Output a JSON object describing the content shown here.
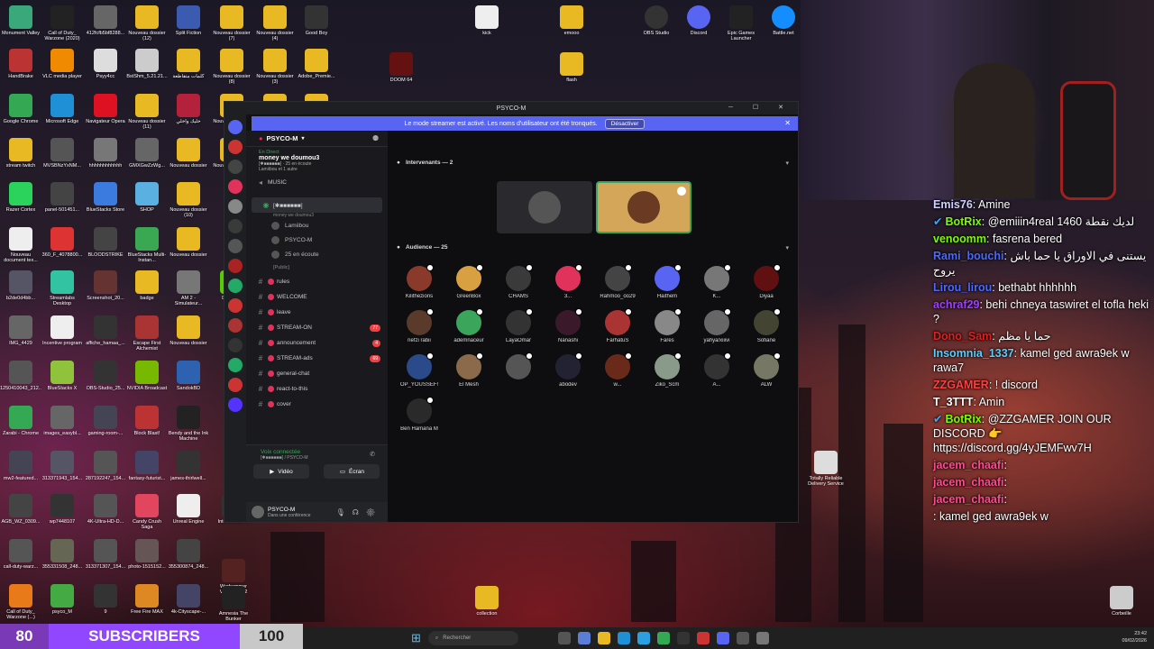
{
  "desktop_icons": [
    {
      "label": "Monument Valley",
      "color": "#3aa87a"
    },
    {
      "label": "Call of Duty_ Warzone (2020)",
      "color": "#222"
    },
    {
      "label": "412fcfb5bf8288...",
      "color": "#666"
    },
    {
      "label": "Nouveau dossier (12)",
      "color": "#e8b923"
    },
    {
      "label": "Split Fiction",
      "color": "#3b5bb0"
    },
    {
      "label": "Nouveau dossier (7)",
      "color": "#e8b923"
    },
    {
      "label": "Nouveau dossier (4)",
      "color": "#e8b923"
    },
    {
      "label": "Good Boy",
      "color": "#333"
    },
    {
      "label": "HandBrake",
      "color": "#b33"
    },
    {
      "label": "VLC media player",
      "color": "#f08a00"
    },
    {
      "label": "Psyy4cc",
      "color": "#ddd"
    },
    {
      "label": "BstShm_5.21.21...",
      "color": "#ccc"
    },
    {
      "label": "كلمات متقاطعة",
      "color": "#e8b923"
    },
    {
      "label": "Nouveau dossier (8)",
      "color": "#e8b923"
    },
    {
      "label": "Nouveau dossier (3)",
      "color": "#e8b923"
    },
    {
      "label": "Adobe_Premie...",
      "color": "#e8b923"
    },
    {
      "label": "Google Chrome",
      "color": "#34a853"
    },
    {
      "label": "Microsoft Edge",
      "color": "#1f8fd6"
    },
    {
      "label": "Navigateur Opera",
      "color": "#d12"
    },
    {
      "label": "Nouveau dossier (11)",
      "color": "#e8b923"
    },
    {
      "label": "خليك واخلي",
      "color": "#b3223a"
    },
    {
      "label": "Nouveau dossier (2)",
      "color": "#e8b923"
    },
    {
      "label": "Nouveau dossier (5)",
      "color": "#e8b923"
    },
    {
      "label": "Nouveau dossier (9)",
      "color": "#e8b923"
    },
    {
      "label": "stream twitch",
      "color": "#e8b923"
    },
    {
      "label": "MVSBNzYxNM...",
      "color": "#555"
    },
    {
      "label": "hhhhhhhhhhhh",
      "color": "#777"
    },
    {
      "label": "GMXGwZzWg...",
      "color": "#666"
    },
    {
      "label": "Nouveau dossier",
      "color": "#e8b923"
    },
    {
      "label": "Nouveau dossier (6)",
      "color": "#e8b923"
    },
    {
      "label": "Nouveau dossier (10)",
      "color": "#e8b923"
    },
    {
      "label": "Razer Cortex",
      "color": "#2bd35c"
    },
    {
      "label": "panel-501451...",
      "color": "#444"
    },
    {
      "label": "BlueStacks Store",
      "color": "#3b7be0"
    },
    {
      "label": "SHOP",
      "color": "#5ab0e0"
    },
    {
      "label": "Nouveau dossier (10)",
      "color": "#e8b923"
    },
    {
      "label": "Nouveau document tex...",
      "color": "#eee"
    },
    {
      "label": "360_F_4078800...",
      "color": "#d33"
    },
    {
      "label": "BLOODSTRIKE",
      "color": "#444"
    },
    {
      "label": "BlueStacks Multi-Instan...",
      "color": "#3aa853"
    },
    {
      "label": "Nouveau dossier",
      "color": "#e8b923"
    },
    {
      "label": "b2de0d4bb...",
      "color": "#556"
    },
    {
      "label": "Streamlabs Desktop",
      "color": "#31c3a2"
    },
    {
      "label": "Screenshot_20...",
      "color": "#633"
    },
    {
      "label": "badge",
      "color": "#e8b923"
    },
    {
      "label": "AM 2 - Simulateur...",
      "color": "#777"
    },
    {
      "label": "Duolingo",
      "color": "#58cc02"
    },
    {
      "label": "IMG_4429",
      "color": "#666"
    },
    {
      "label": "Incentive program",
      "color": "#eee"
    },
    {
      "label": "affiche_hamaa_...",
      "color": "#333"
    },
    {
      "label": "Escape First Alchemist",
      "color": "#a33"
    },
    {
      "label": "Nouveau dossier",
      "color": "#e8b923"
    },
    {
      "label": "1250410043_212...",
      "color": "#555"
    },
    {
      "label": "BlueStacks X",
      "color": "#8fc33b"
    },
    {
      "label": "OBS-Studio_25...",
      "color": "#333"
    },
    {
      "label": "NVIDIA Broadcast",
      "color": "#76b900"
    },
    {
      "label": "SandokBD",
      "color": "#2c62b0"
    },
    {
      "label": "Zarabi - Chrome",
      "color": "#34a853"
    },
    {
      "label": "images_easybl...",
      "color": "#666"
    },
    {
      "label": "gaming-room-...",
      "color": "#445"
    },
    {
      "label": "Block Blast!",
      "color": "#b33"
    },
    {
      "label": "Bendy and the Ink Machine",
      "color": "#222"
    },
    {
      "label": "mw2-featured...",
      "color": "#445"
    },
    {
      "label": "313371943_154...",
      "color": "#556"
    },
    {
      "label": "287192247_154...",
      "color": "#555"
    },
    {
      "label": "fantasy-futurist...",
      "color": "#446"
    },
    {
      "label": "james-thirlwell...",
      "color": "#333"
    },
    {
      "label": "AGB_WZ_0309...",
      "color": "#444"
    },
    {
      "label": "wp7448107",
      "color": "#333"
    },
    {
      "label": "4K-Ultra-HD-D...",
      "color": "#555"
    },
    {
      "label": "Candy Crush Saga",
      "color": "#e2455e"
    },
    {
      "label": "Unreal Engine",
      "color": "#eee"
    },
    {
      "label": "call-duty-warz...",
      "color": "#555"
    },
    {
      "label": "355331508_248...",
      "color": "#665"
    },
    {
      "label": "313371307_154...",
      "color": "#555"
    },
    {
      "label": "photo-1515152...",
      "color": "#655"
    },
    {
      "label": "355300874_248...",
      "color": "#444"
    },
    {
      "label": "Call of Duty_ Warzone (...)",
      "color": "#e87a1a"
    },
    {
      "label": "psyco_M",
      "color": "#4a4"
    },
    {
      "label": "9",
      "color": "#333"
    },
    {
      "label": "Free Fire MAX",
      "color": "#d82"
    },
    {
      "label": "4k-Cityscape-...",
      "color": "#446"
    }
  ],
  "desktop_icons2": [
    {
      "label": "kick",
      "color": "#eee"
    },
    {
      "label": "emooo",
      "color": "#e8b923"
    },
    {
      "label": "OBS Studio",
      "color": "#333"
    },
    {
      "label": "Discord",
      "color": "#5865f2"
    },
    {
      "label": "Epic Games Launcher",
      "color": "#222"
    },
    {
      "label": "Battle.net",
      "color": "#148eff"
    },
    {
      "label": "DOOM 64",
      "color": "#611"
    },
    {
      "label": "flash",
      "color": "#e8b923"
    },
    {
      "label": "Intervention ...",
      "color": "#333"
    },
    {
      "label": "Warhammer Vermintide 2",
      "color": "#522"
    },
    {
      "label": "Amnesia The Bunker",
      "color": "#222"
    },
    {
      "label": "Totally Reliable Delivery Service",
      "color": "#ddd"
    },
    {
      "label": "collection",
      "color": "#e8b923"
    },
    {
      "label": "Corbeille",
      "color": "#ccc"
    }
  ],
  "discord": {
    "window_title": "PSYCO-M",
    "banner_text": "Le mode streamer est activé. Les noms d'utilisateur ont été tronqués.",
    "banner_button": "Désactiver",
    "server_name": "PSYCO-M",
    "event_status": "En Direct",
    "event_title": "money we doumou3",
    "event_sub": "[✱■■■■■■] · 25 en écoute",
    "event_users": "Lamiibou et 1 autre",
    "music": "MUSIC",
    "stage_channel": "[✱■■■■■■]",
    "stage_sub": "money we doumou3",
    "voice_users": [
      "Lamiibou",
      "PSYCO-M",
      "25 en écoute"
    ],
    "public_cat": "[Public]",
    "channels": [
      {
        "name": "rules",
        "count": ""
      },
      {
        "name": "WELCOME",
        "count": ""
      },
      {
        "name": "leave",
        "count": ""
      },
      {
        "name": "STREAM-ON",
        "count": "77"
      },
      {
        "name": "announcement",
        "count": "4"
      },
      {
        "name": "STREAM-ads",
        "count": "69"
      },
      {
        "name": "general-chat",
        "count": ""
      },
      {
        "name": "react-to-this",
        "count": ""
      },
      {
        "name": "cover",
        "count": ""
      }
    ],
    "voice_connected": "Voix connectée",
    "voice_sub": "[✱■■■■■■] / PSYCO-M",
    "video_btn": "Vidéo",
    "screen_btn": "Écran",
    "user_name": "PSYCO-M",
    "user_status": "Dans une conférence",
    "speakers_label": "Intervenants — 2",
    "audience_label": "Audience — 25",
    "audience": [
      {
        "name": "Kilithezions",
        "color": "#8a3a2a"
      },
      {
        "name": "GreenBox",
        "color": "#d8a040"
      },
      {
        "name": "CHAMS",
        "color": "#3a3a3a"
      },
      {
        "name": "3...",
        "color": "#e0325a"
      },
      {
        "name": "Rahmoo_oo29",
        "color": "#444"
      },
      {
        "name": "Haithem",
        "color": "#5865f2"
      },
      {
        "name": "K...",
        "color": "#777"
      },
      {
        "name": "Diyaa",
        "color": "#601010"
      },
      {
        "name": "nefzi rabii",
        "color": "#5a3a2a"
      },
      {
        "name": "ademnaceur",
        "color": "#3ba55c"
      },
      {
        "name": "LayaOmar",
        "color": "#333"
      },
      {
        "name": "Nanashi",
        "color": "#3a1a2a"
      },
      {
        "name": "FarhatuS",
        "color": "#a33"
      },
      {
        "name": "Fares",
        "color": "#888"
      },
      {
        "name": "yahya/xiiivi",
        "color": "#666"
      },
      {
        "name": "Sofiane",
        "color": "#443"
      },
      {
        "name": "OP_YOUSSEF!",
        "color": "#2a4a8a"
      },
      {
        "name": "El Mesh",
        "color": "#8a6a4a"
      },
      {
        "name": "",
        "color": "#555"
      },
      {
        "name": "abodev",
        "color": "#223"
      },
      {
        "name": "w...",
        "color": "#6a2a1a"
      },
      {
        "name": "Ziko_Scm",
        "color": "#8a9a8a"
      },
      {
        "name": "A...",
        "color": "#333"
      },
      {
        "name": "ALW",
        "color": "#776"
      },
      {
        "name": "Ben Hamana M",
        "color": "#2a2a2a"
      }
    ]
  },
  "chat": [
    {
      "user": "Emis76",
      "text": ": Amine",
      "color": "#d0d0ff",
      "badge": ""
    },
    {
      "user": "BotRix",
      "text": ": @emiiin4real 1460 لديك نقطة",
      "color": "#7cfc00",
      "badge": "✔"
    },
    {
      "user": "venoomm",
      "text": ": fasrena bered",
      "color": "#7cfc00",
      "badge": ""
    },
    {
      "user": "Rami_bouchi",
      "text": ": يستنى في الاوراق يا حما باش يروح",
      "color": "#4a6aff",
      "badge": ""
    },
    {
      "user": "Lirou_lirou",
      "text": ": bethabt hhhhhh",
      "color": "#4a6aff",
      "badge": ""
    },
    {
      "user": "achraf29",
      "text": ": behi chneya taswiret el tofla heki ?",
      "color": "#a040ff",
      "badge": ""
    },
    {
      "user": "Dono_Sam",
      "text": ": حما يا مظم",
      "color": "#e02020",
      "badge": ""
    },
    {
      "user": "Insomnia_1337",
      "text": ": kamel ged awra9ek w rawa7",
      "color": "#5ad0ff",
      "badge": ""
    },
    {
      "user": "ZZGAMER",
      "text": ": ! discord",
      "color": "#ff4040",
      "badge": ""
    },
    {
      "user": "T_3TTT",
      "text": ": Amin",
      "color": "#ffffff",
      "badge": ""
    },
    {
      "user": "BotRix",
      "text": ": @ZZGAMER JOIN OUR DISCORD 👉 https://discord.gg/4yJEMFwv7H",
      "color": "#7cfc00",
      "badge": "✔"
    },
    {
      "user": "jacem_chaafi",
      "text": ":",
      "color": "#ff4a90",
      "badge": ""
    },
    {
      "user": "jacem_chaafi",
      "text": ":",
      "color": "#ff4a90",
      "badge": ""
    },
    {
      "user": "jacem_chaafi",
      "text": ":",
      "color": "#ff4a90",
      "badge": ""
    },
    {
      "user": "",
      "text": ": kamel ged awra9ek w",
      "color": "#fff",
      "badge": ""
    }
  ],
  "subs": {
    "current": "80",
    "label": "SUBSCRIBERS",
    "goal": "100"
  },
  "taskbar": {
    "search_placeholder": "Rechercher",
    "time": "23:42",
    "date": "09/02/2026"
  }
}
